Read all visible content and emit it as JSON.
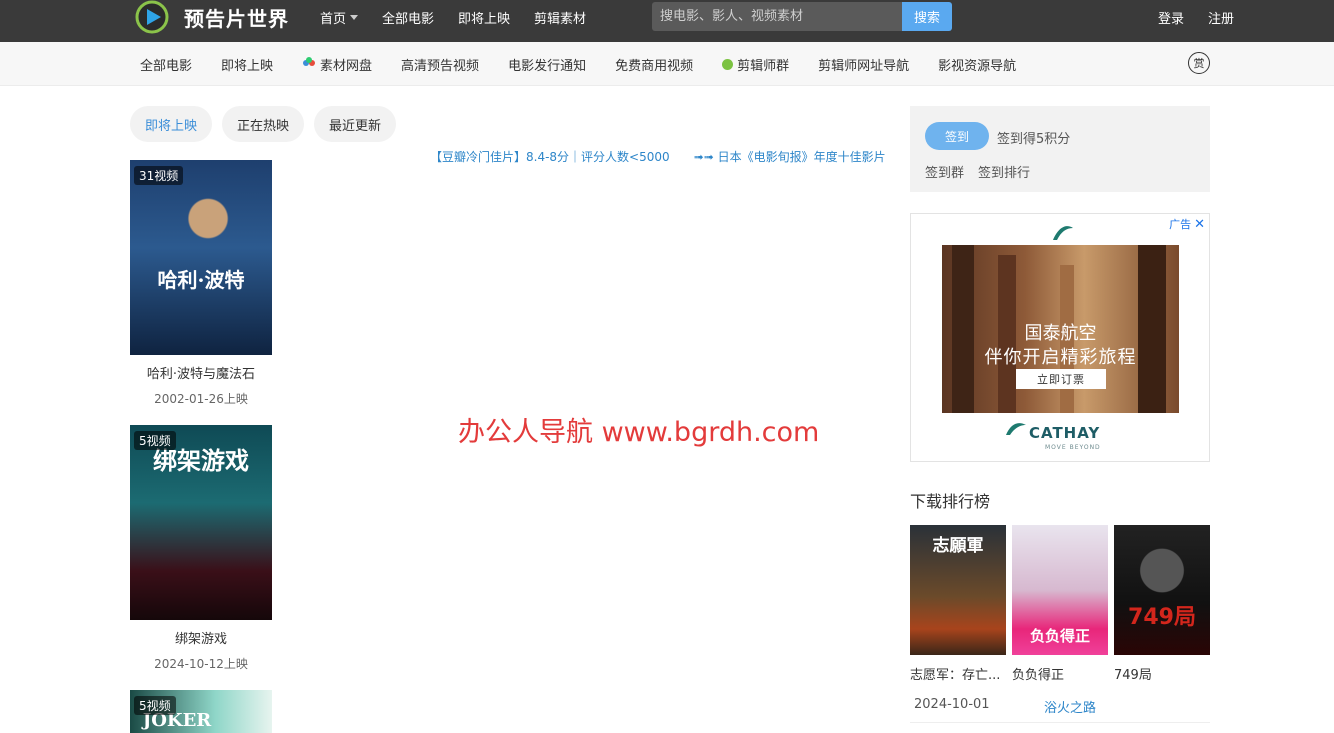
{
  "header": {
    "logo_text": "预告片世界",
    "nav": [
      {
        "label": "首页",
        "has_dropdown": true
      },
      {
        "label": "全部电影",
        "has_dropdown": false
      },
      {
        "label": "即将上映",
        "has_dropdown": false
      },
      {
        "label": "剪辑素材",
        "has_dropdown": false
      }
    ],
    "search": {
      "placeholder": "搜电影、影人、视频素材",
      "button_label": "搜索"
    },
    "login_label": "登录",
    "register_label": "注册"
  },
  "subnav": {
    "items": [
      {
        "label": "全部电影",
        "icon": ""
      },
      {
        "label": "即将上映",
        "icon": ""
      },
      {
        "label": "素材网盘",
        "icon": "cloud-icon"
      },
      {
        "label": "高清预告视频",
        "icon": ""
      },
      {
        "label": "电影发行通知",
        "icon": ""
      },
      {
        "label": "免费商用视频",
        "icon": ""
      },
      {
        "label": "剪辑师群",
        "icon": "wechat-icon"
      },
      {
        "label": "剪辑师网址导航",
        "icon": ""
      },
      {
        "label": "影视资源导航",
        "icon": ""
      }
    ],
    "reward_label": "赏"
  },
  "tabs": [
    {
      "label": "即将上映",
      "active": true
    },
    {
      "label": "正在热映",
      "active": false
    },
    {
      "label": "最近更新",
      "active": false
    }
  ],
  "tips": [
    "【豆瓣冷门佳片】8.4-8分｜评分人数<5000",
    "➟➟ 日本《电影旬报》年度十佳影片"
  ],
  "movies": [
    {
      "badge": "31视频",
      "name": "哈利·波特与魔法石",
      "date": "2002-01-26上映",
      "poster_title": "哈利·波特"
    },
    {
      "badge": "5视频",
      "name": "绑架游戏",
      "date": "2024-10-12上映",
      "poster_title": "绑架游戏"
    },
    {
      "badge": "5视频",
      "name": "",
      "date": "",
      "poster_title": "JOKER"
    }
  ],
  "watermark": "办公人导航  www.bgrdh.com",
  "signin": {
    "button_label": "签到",
    "reward_text": "签到得5积分",
    "links": [
      "签到群",
      "签到排行"
    ]
  },
  "ad": {
    "label": "广告",
    "line1": "国泰航空",
    "line2": "伴你开启精彩旅程",
    "cta": "立即订票",
    "brand": "CATHAY",
    "slogan": "MOVE BEYOND"
  },
  "ranking": {
    "title": "下载排行榜",
    "items": [
      {
        "name": "志愿军：存亡...",
        "poster_title": "志願軍"
      },
      {
        "name": "负负得正",
        "poster_title": "负负得正"
      },
      {
        "name": "749局",
        "poster_title": "749局"
      }
    ],
    "date": "2024-10-01",
    "link": "浴火之路"
  },
  "colors": {
    "accent": "#5aa9f0",
    "topbar": "#3a3a3a",
    "link": "#2e86c9",
    "watermark": "#e33b3b"
  }
}
